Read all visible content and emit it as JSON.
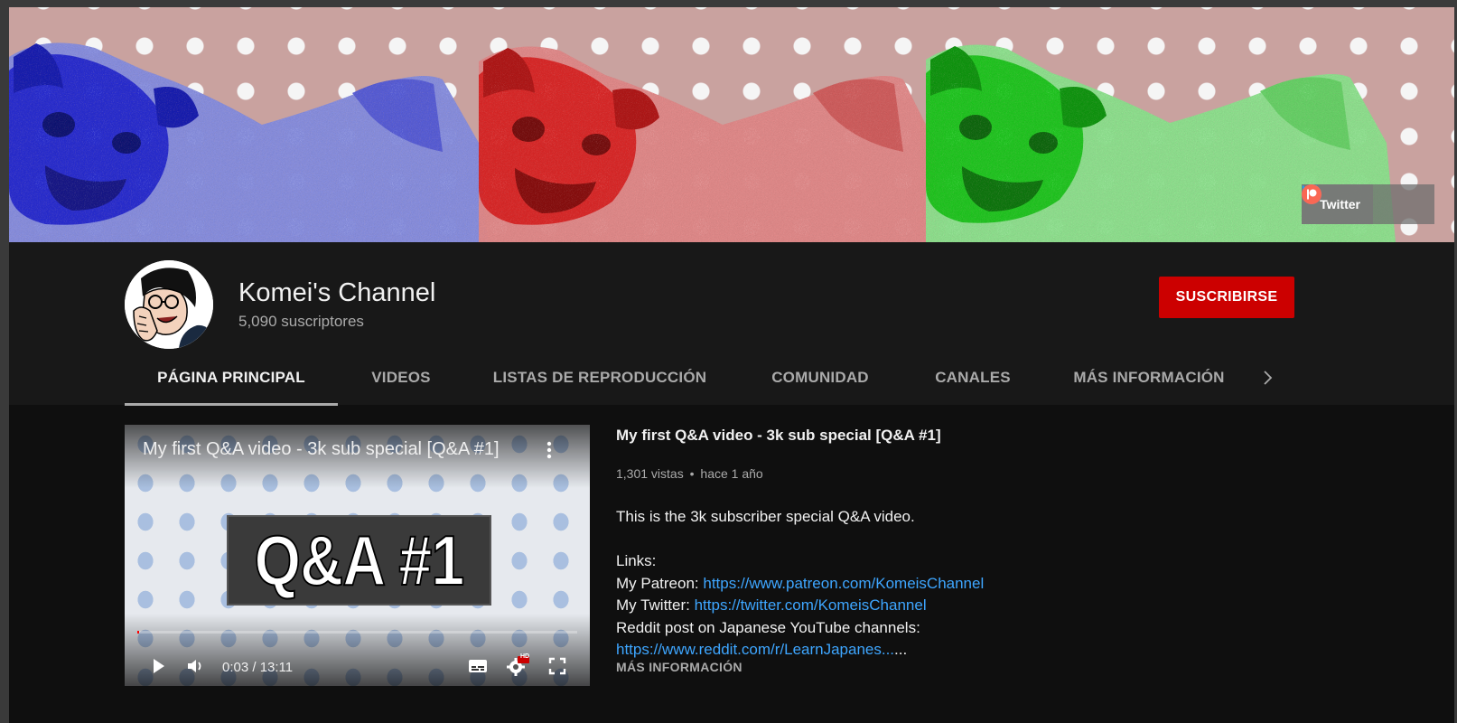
{
  "banner": {
    "links": [
      {
        "label": "Twitter",
        "icon": "twitter-icon"
      },
      {
        "label": "",
        "icon": "discord-icon"
      },
      {
        "label": "",
        "icon": "patreon-icon"
      }
    ]
  },
  "channel": {
    "name": "Komei's Channel",
    "subscribers": "5,090 suscriptores",
    "subscribe_label": "SUSCRIBIRSE"
  },
  "tabs": [
    {
      "label": "PÁGINA PRINCIPAL",
      "active": true
    },
    {
      "label": "VIDEOS",
      "active": false
    },
    {
      "label": "LISTAS DE REPRODUCCIÓN",
      "active": false
    },
    {
      "label": "COMUNIDAD",
      "active": false
    },
    {
      "label": "CANALES",
      "active": false
    },
    {
      "label": "MÁS INFORMACIÓN",
      "active": false
    }
  ],
  "featured": {
    "player_title": "My first Q&A video - 3k sub special [Q&A #1]",
    "thumbnail_text": "Q&A #1",
    "current_time": "0:03 / 13:11",
    "progress": 0.004,
    "hd_badge": "HD",
    "title": "My first Q&A video - 3k sub special [Q&A #1]",
    "views": "1,301 vistas",
    "separator": "•",
    "age": "hace 1 año",
    "description": {
      "intro": "This is the 3k subscriber special Q&A video.",
      "links_heading": "Links:",
      "patreon_prefix": "My Patreon: ",
      "patreon_url": "https://www.patreon.com/KomeisChannel",
      "twitter_prefix": "My Twitter: ",
      "twitter_url": "https://twitter.com/KomeisChannel",
      "reddit_line": "Reddit post on Japanese YouTube channels:",
      "reddit_url": "https://www.reddit.com/r/LearnJapanes...",
      "ellipsis": "..."
    },
    "more_label": "MÁS INFORMACIÓN"
  },
  "colors": {
    "subscribe": "#cc0000",
    "link": "#3ea6ff",
    "progress": "#ff0000"
  }
}
